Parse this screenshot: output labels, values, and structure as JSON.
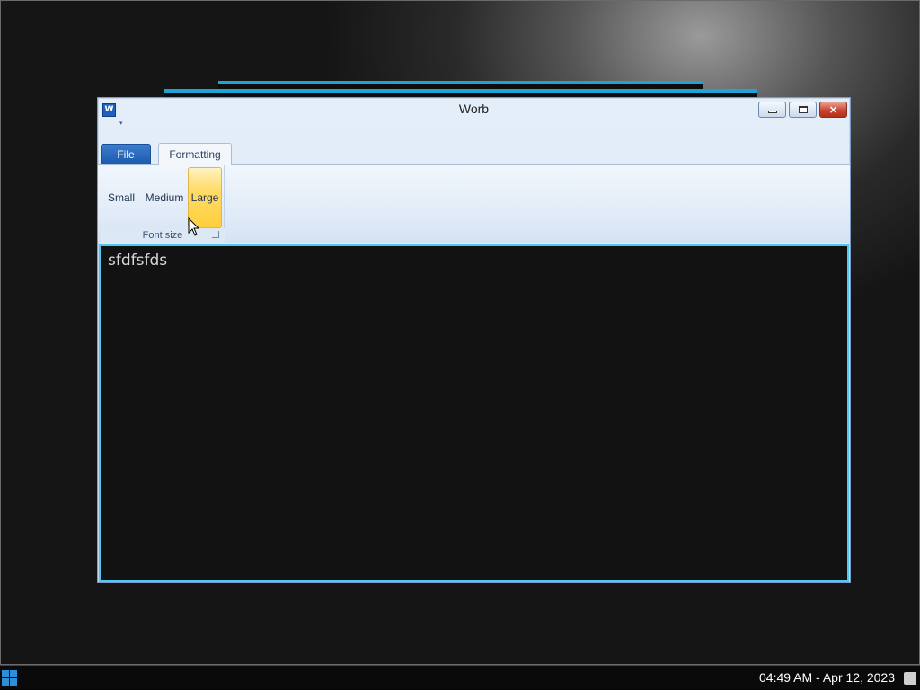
{
  "window": {
    "title": "Worb",
    "icon": "word-app-icon",
    "icon_letter": "W",
    "qat_arrow": "▾",
    "controls": {
      "minimize": "minimize-icon",
      "maximize": "maximize-icon",
      "close": "×"
    }
  },
  "ribbon": {
    "tabs": [
      {
        "label": "File",
        "selected": false
      },
      {
        "label": "Formatting",
        "selected": true
      }
    ],
    "groups": [
      {
        "label": "Font size",
        "buttons": [
          {
            "label": "Small",
            "active": false
          },
          {
            "label": "Medium",
            "active": false
          },
          {
            "label": "Large",
            "active": true
          }
        ]
      }
    ]
  },
  "document": {
    "text": "sfdfsfds"
  },
  "taskbar": {
    "clock": "04:49 AM - Apr 12, 2023"
  },
  "colors": {
    "accent": "#4fc8ef",
    "file_tab": "#1c5bb0",
    "active_button": "#ffcf3c",
    "document_bg": "#121212"
  }
}
